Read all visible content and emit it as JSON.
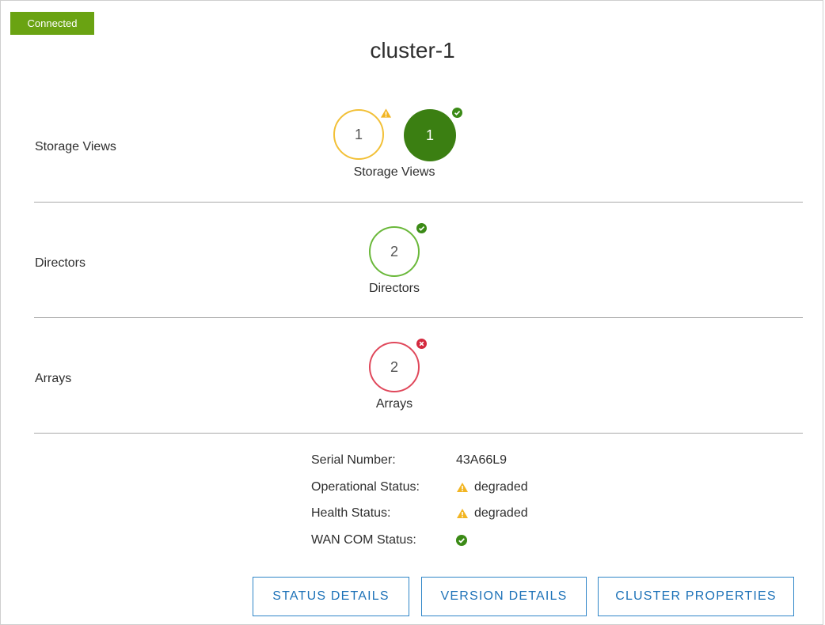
{
  "connection_status": "Connected",
  "cluster_name": "cluster-1",
  "sections": {
    "storage_views": {
      "row_label": "Storage Views",
      "caption": "Storage Views",
      "warning_count": "1",
      "ok_count": "1"
    },
    "directors": {
      "row_label": "Directors",
      "caption": "Directors",
      "ok_count": "2"
    },
    "arrays": {
      "row_label": "Arrays",
      "caption": "Arrays",
      "error_count": "2"
    }
  },
  "properties": {
    "serial_label": "Serial Number:",
    "serial_value": "43A66L9",
    "operational_label": "Operational Status:",
    "operational_value": "degraded",
    "health_label": "Health Status:",
    "health_value": "degraded",
    "wan_label": "WAN COM Status:"
  },
  "buttons": {
    "status_details": "STATUS DETAILS",
    "version_details": "VERSION DETAILS",
    "cluster_properties": "CLUSTER PROPERTIES"
  },
  "icons": {
    "warning": "warning-icon",
    "ok": "check-circle-icon",
    "error": "error-circle-icon"
  },
  "colors": {
    "connected_badge": "#6aa312",
    "warning": "#f2c037",
    "ok_fill": "#3b7f12",
    "ok_ring": "#6ab83a",
    "error": "#e0485b",
    "button_accent": "#1d72b8"
  }
}
